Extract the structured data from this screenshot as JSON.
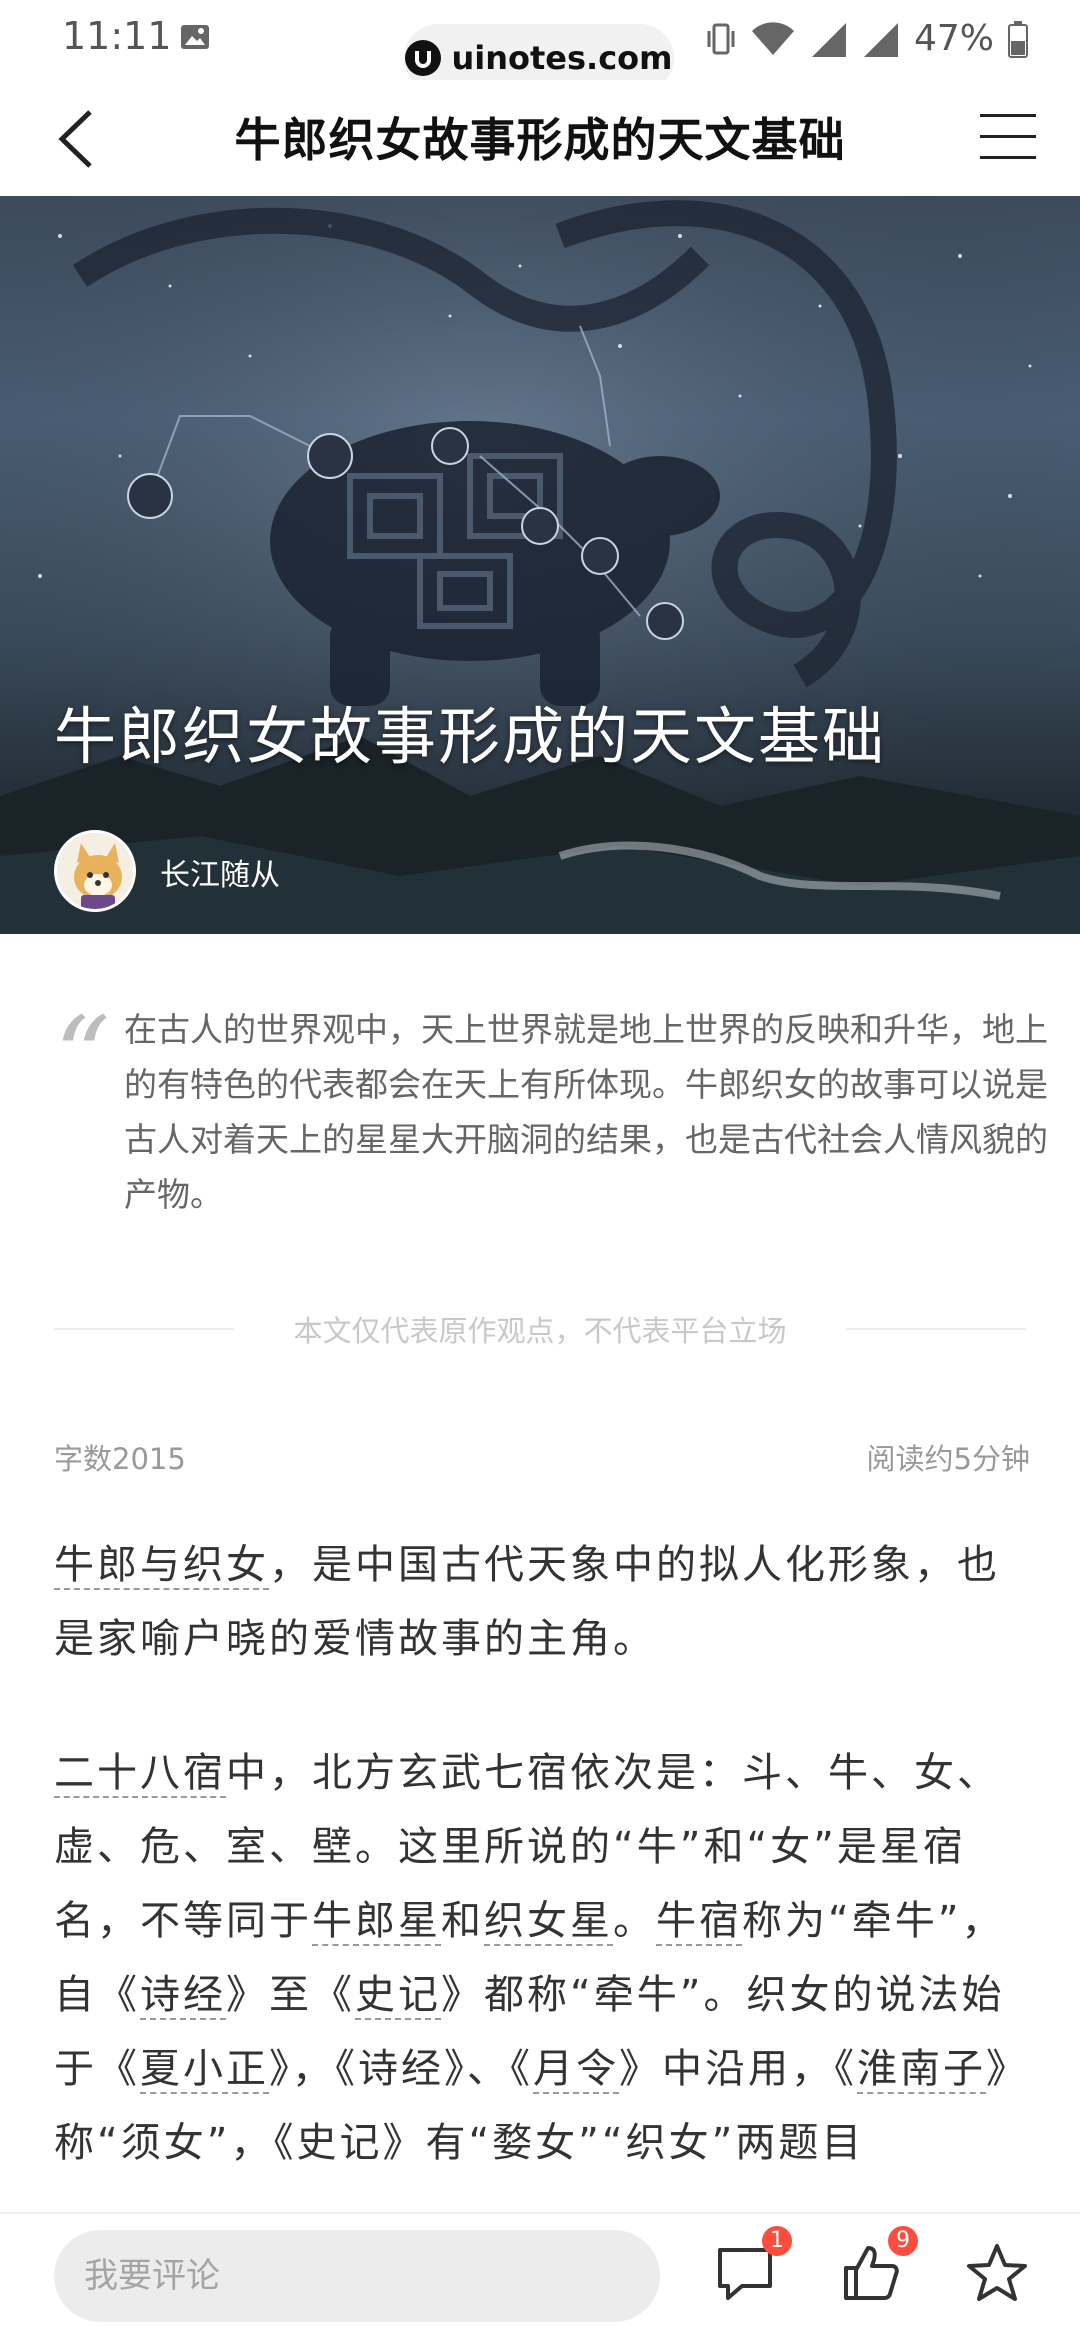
{
  "status_bar": {
    "time": "11:11",
    "url": "uinotes.com",
    "battery": "47%"
  },
  "nav": {
    "title": "牛郎织女故事形成的天文基础"
  },
  "hero": {
    "title": "牛郎织女故事形成的天文基础",
    "author": "长江随从"
  },
  "summary": {
    "text": "在古人的世界观中，天上世界就是地上世界的反映和升华，地上的有特色的代表都会在天上有所体现。牛郎织女的故事可以说是古人对着天上的星星大开脑洞的结果，也是古代社会人情风貌的产物。"
  },
  "disclaimer": "本文仅代表原作观点，不代表平台立场",
  "meta": {
    "word_count": "字数2015",
    "read_time": "阅读约5分钟"
  },
  "article": {
    "p1": {
      "link1": "牛郎与织女",
      "text1": "，是中国古代天象中的拟人化形象，也是家喻户晓的爱情故事的主角。"
    },
    "p2": {
      "link1": "二十八宿",
      "t1": "中，北方玄武七宿依次是：斗、牛、女、虚、危、室、壁。这里所说的“牛”和“女”是星宿名，不等同于",
      "link2": "牛郎星",
      "t2": "和",
      "link3": "织女星",
      "t3": "。",
      "link4": "牛宿",
      "t4": "称为“牵牛”，自《",
      "link5": "诗经",
      "t5": "》至《",
      "link6": "史记",
      "t6": "》都称“牵牛”。织女的说法始于《",
      "link7": "夏小正",
      "t7": "》，《诗经》、《",
      "link8": "月令",
      "t8": "》中沿用，《",
      "link9": "淮南子",
      "t9": "》称“须女”，《史记》有“婺女”“织女”两题目"
    }
  },
  "bottom_bar": {
    "comment_placeholder": "我要评论",
    "comment_count": "1",
    "like_count": "9"
  },
  "icons": {
    "back": "chevron-left-icon",
    "menu": "hamburger-menu-icon",
    "comment": "comment-bubble-icon",
    "like": "thumbs-up-icon",
    "favorite": "star-icon"
  },
  "colors": {
    "badge": "#ff4d3d",
    "link_underline": "#999999"
  }
}
